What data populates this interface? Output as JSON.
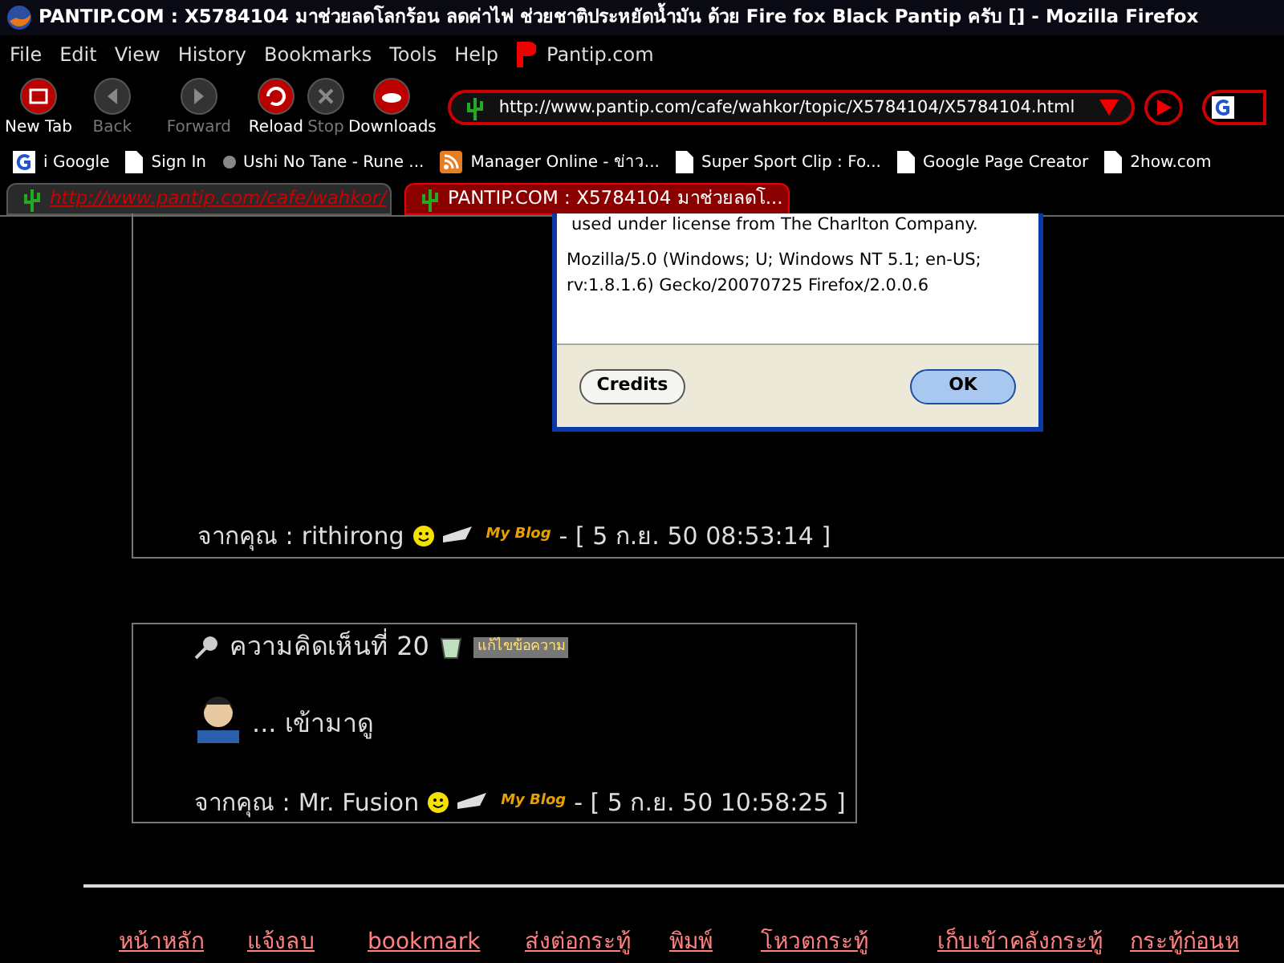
{
  "window": {
    "title": "PANTIP.COM : X5784104 มาช่วยลดโลกร้อน ลดค่าไฟ ช่วยชาติประหยัดน้ำมัน ด้วย Fire fox Black Pantip ครับ [] - Mozilla Firefox"
  },
  "menu": [
    "File",
    "Edit",
    "View",
    "History",
    "Bookmarks",
    "Tools",
    "Help"
  ],
  "menu_site": "Pantip.com",
  "toolbar": [
    {
      "label": "New Tab",
      "kind": "newtab",
      "disabled": false
    },
    {
      "label": "Back",
      "kind": "back",
      "disabled": true
    },
    {
      "label": "Forward",
      "kind": "forward",
      "disabled": true
    },
    {
      "label": "Reload",
      "kind": "reload",
      "disabled": false
    },
    {
      "label": "Stop",
      "kind": "stop",
      "disabled": true
    },
    {
      "label": "Downloads",
      "kind": "downloads",
      "disabled": false
    }
  ],
  "address": {
    "value": "http://www.pantip.com/cafe/wahkor/topic/X5784104/X5784104.html"
  },
  "bookmarks": [
    {
      "label": "i Google",
      "kind": "google"
    },
    {
      "label": "Sign In",
      "kind": "page"
    },
    {
      "label": "Ushi No Tane - Rune ...",
      "kind": "dot"
    },
    {
      "label": "Manager Online - ข่าว...",
      "kind": "rss"
    },
    {
      "label": "Super Sport Clip : Fo...",
      "kind": "page"
    },
    {
      "label": "Google Page Creator",
      "kind": "page"
    },
    {
      "label": "2how.com",
      "kind": "page"
    }
  ],
  "tabs": [
    {
      "label": "http://www.pantip.com/cafe/wahkor/",
      "selected": false
    },
    {
      "label": "PANTIP.COM : X5784104 มาช่วยลดโ...",
      "selected": true
    }
  ],
  "dialog": {
    "license": "used under license from The Charlton Company.",
    "user_agent_1": "Mozilla/5.0 (Windows; U; Windows NT 5.1; en-US;",
    "user_agent_2": "rv:1.8.1.6) Gecko/20070725 Firefox/2.0.0.6",
    "buttons": [
      "Credits",
      "OK"
    ]
  },
  "posts": [
    {
      "from_label": "จากคุณ :",
      "author": "rithirong",
      "blog": "My Blog",
      "timestamp": "- [ 5 ก.ย. 50 08:53:14 ]"
    },
    {
      "heading": "ความคิดเห็นที่ 20",
      "edit": "แก้ไขข้อความ",
      "body": "... เข้ามาดู",
      "from_label": "จากคุณ :",
      "author": "Mr. Fusion",
      "blog": "My Blog",
      "timestamp": "- [ 5 ก.ย. 50 10:58:25 ]"
    }
  ],
  "footer_links": [
    "หน้าหลัก",
    "แจ้งลบ",
    "bookmark",
    "ส่งต่อกระทู้",
    "พิมพ์",
    "โหวตกระทู้",
    "เก็บเข้าคลังกระทู้",
    "กระทู้ก่อนห"
  ]
}
